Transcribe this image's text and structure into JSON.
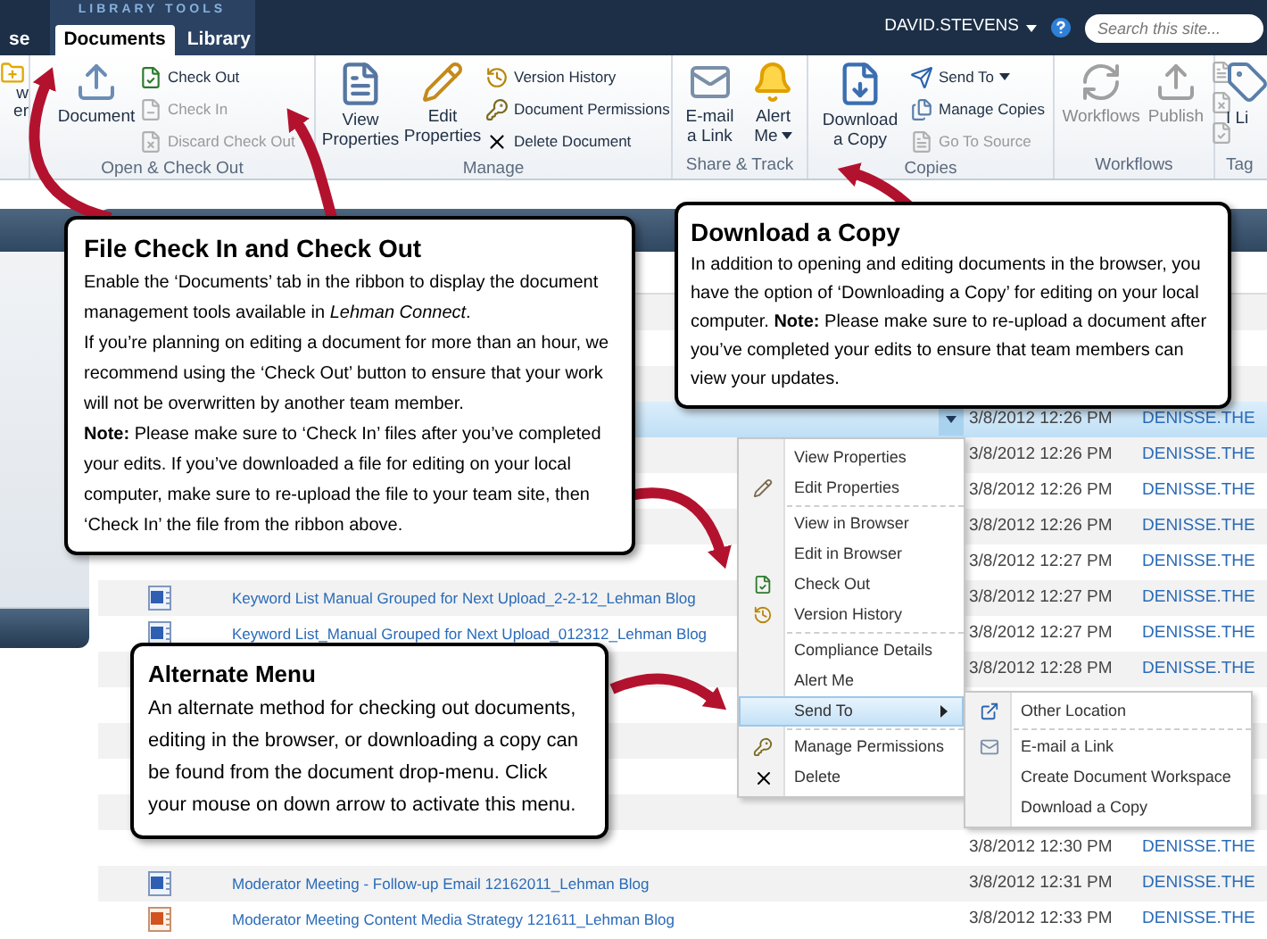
{
  "top_bar": {
    "tabs": [
      {
        "label": "se",
        "selected": false
      },
      {
        "label": "Documents",
        "selected": true
      },
      {
        "label": "Library",
        "selected": false
      }
    ],
    "context_label": "LIBRARY TOOLS",
    "user": "DAVID.STEVENS",
    "search": {
      "placeholder": "Search this site..."
    }
  },
  "ribbon": {
    "new_group": {
      "label_lines": [
        "w",
        "er"
      ]
    },
    "open_check_out": {
      "label": "Open & Check Out",
      "upload": "Document",
      "check_out": {
        "label": "Check Out",
        "disabled": false
      },
      "check_in": {
        "label": "Check In",
        "disabled": true
      },
      "discard": {
        "label": "Discard Check Out",
        "disabled": true
      }
    },
    "manage": {
      "label": "Manage",
      "view_properties": "View Properties",
      "edit_properties": "Edit Properties",
      "version_history": "Version History",
      "document_permissions": "Document Permissions",
      "delete_document": "Delete Document"
    },
    "share_track": {
      "label": "Share & Track",
      "email": "E-mail a Link",
      "alert": "Alert Me"
    },
    "copies": {
      "label": "Copies",
      "download": "Download a Copy",
      "send_to": "Send To",
      "manage_copies": "Manage Copies",
      "go_to_source": {
        "label": "Go To Source",
        "disabled": true
      }
    },
    "workflows": {
      "label": "Workflows",
      "workflows": {
        "label": "Workflows",
        "disabled": true
      },
      "publish": {
        "label": "Publish",
        "disabled": true
      }
    },
    "tags": {
      "label": "Tag",
      "button": "I Li"
    }
  },
  "document_list": {
    "rows": [
      {
        "selected": false
      },
      {
        "selected": false
      },
      {
        "selected": false
      },
      {
        "selected": true,
        "modified": "3/8/2012 12:26 PM",
        "modified_by": "DENISSE.THE"
      },
      {
        "selected": false,
        "modified": "3/8/2012 12:26 PM",
        "modified_by": "DENISSE.THE"
      },
      {
        "selected": false,
        "modified": "3/8/2012 12:26 PM",
        "modified_by": "DENISSE.THE"
      },
      {
        "selected": false,
        "modified": "3/8/2012 12:26 PM",
        "modified_by": "DENISSE.THE"
      },
      {
        "selected": false,
        "modified": "3/8/2012 12:27 PM",
        "modified_by": "DENISSE.THE"
      },
      {
        "selected": false,
        "kind": "word",
        "name": "Keyword List Manual Grouped for Next Upload_2-2-12_Lehman Blog",
        "modified": "3/8/2012 12:27 PM",
        "modified_by": "DENISSE.THE"
      },
      {
        "selected": false,
        "kind": "word",
        "name": "Keyword List_Manual Grouped for Next Upload_012312_Lehman Blog",
        "modified": "3/8/2012 12:27 PM",
        "modified_by": "DENISSE.THE"
      },
      {
        "selected": false,
        "modified": "3/8/2012 12:28 PM",
        "modified_by": "DENISSE.THE"
      },
      {
        "selected": false
      },
      {
        "selected": false
      },
      {
        "selected": false
      },
      {
        "selected": false
      },
      {
        "selected": false,
        "modified": "3/8/2012 12:30 PM",
        "modified_by": "DENISSE.THE"
      },
      {
        "selected": false,
        "kind": "word",
        "name": "Moderator Meeting - Follow-up Email 12162011_Lehman Blog",
        "modified": "3/8/2012 12:31 PM",
        "modified_by": "DENISSE.THE"
      },
      {
        "selected": false,
        "kind": "powerpoint",
        "name": "Moderator Meeting Content Media Strategy 121611_Lehman Blog",
        "modified": "3/8/2012 12:33 PM",
        "modified_by": "DENISSE.THE"
      }
    ]
  },
  "context_menu": {
    "groups": [
      {
        "items": [
          {
            "label": "View Properties",
            "highlighted": false
          },
          {
            "label": "Edit Properties",
            "highlighted": false
          }
        ]
      },
      {
        "items": [
          {
            "label": "View in Browser",
            "highlighted": false
          },
          {
            "label": "Edit in Browser",
            "highlighted": false
          },
          {
            "label": "Check Out",
            "highlighted": false
          },
          {
            "label": "Version History",
            "highlighted": false
          }
        ]
      },
      {
        "items": [
          {
            "label": "Compliance Details",
            "highlighted": false
          },
          {
            "label": "Alert Me",
            "highlighted": false
          },
          {
            "label": "Send To",
            "highlighted": true,
            "submenu": {
              "groups": [
                {
                  "items": [
                    {
                      "label": "Other Location",
                      "highlighted": false
                    }
                  ]
                },
                {
                  "items": [
                    {
                      "label": "E-mail a Link",
                      "highlighted": false
                    },
                    {
                      "label": "Create Document Workspace",
                      "highlighted": false
                    },
                    {
                      "label": "Download a Copy",
                      "highlighted": false
                    }
                  ]
                }
              ]
            }
          }
        ]
      },
      {
        "items": [
          {
            "label": "Manage Permissions",
            "highlighted": false
          },
          {
            "label": "Delete",
            "highlighted": false
          }
        ]
      }
    ]
  },
  "callouts": [
    {
      "title": "File Check In and Check Out",
      "paragraphs": [
        "Enable the ‘Documents’ tab in the ribbon to display the document management tools available in *Lehman Connect*.",
        "If you’re planning on editing a document for more than an hour, we recommend using the ‘Check Out’ button to ensure that your work will not be overwritten by another team member.",
        "**Note:** Please make sure to ‘Check In’ files after you’ve completed your edits.  If you’ve downloaded a file for editing on your local computer, make sure to re-upload the file to your team site, then ‘Check In’ the file from the ribbon above."
      ]
    },
    {
      "title": "Download a Copy",
      "paragraphs": [
        "In addition to opening and editing documents in the browser, you have the option of ‘Downloading a Copy’ for editing on your local computer.  **Note:**  Please make sure to re-upload a document after you’ve completed your edits to ensure that team members can view your updates."
      ]
    },
    {
      "title": "Alternate Menu",
      "paragraphs": [
        "An alternate method for checking out documents, editing in the browser, or downloading a copy can be found from the document drop-menu. Click your mouse on down arrow to activate this menu."
      ]
    }
  ]
}
